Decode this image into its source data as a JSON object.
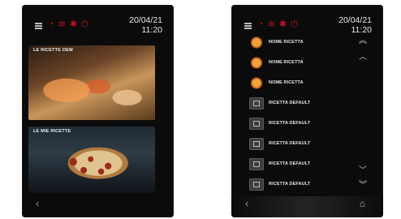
{
  "left_screen": {
    "date": "20/04/21",
    "time": "11:20",
    "panels": [
      {
        "label": "LE RICETTE OEM"
      },
      {
        "label": "LE MIE RICETTE"
      }
    ]
  },
  "right_screen": {
    "date": "20/04/21",
    "time": "11:20",
    "recipes": [
      {
        "icon": "pizza-icon",
        "label": "NOME RICETTA"
      },
      {
        "icon": "pizza-icon",
        "label": "NOME RICETTA"
      },
      {
        "icon": "pizza-icon",
        "label": "NOME RICETTA"
      },
      {
        "icon": "recipe-icon",
        "label": "RICETTA DEFAULT"
      },
      {
        "icon": "recipe-icon",
        "label": "RICETTA DEFAULT"
      },
      {
        "icon": "recipe-icon",
        "label": "RICETTA DEFAULT"
      },
      {
        "icon": "recipe-icon",
        "label": "RICETTA DEFAULT"
      },
      {
        "icon": "recipe-icon",
        "label": "RICETTA DEFAULT"
      }
    ]
  },
  "colors": {
    "accent_red": "#c1121f",
    "screen_bg": "#0b0b0b"
  }
}
